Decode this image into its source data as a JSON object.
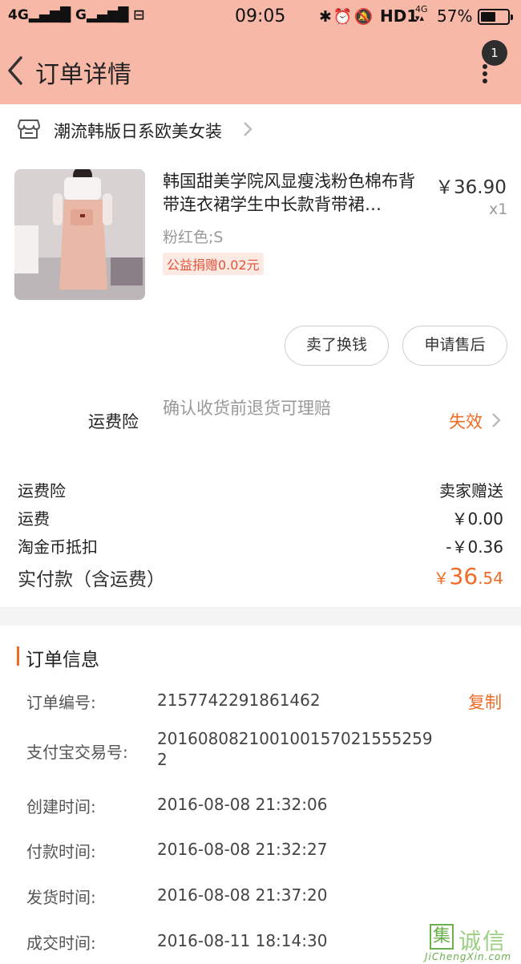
{
  "status_bar": {
    "signal": "4G",
    "signal2": "G",
    "time": "09:05",
    "hd": "HD1",
    "net": "4G",
    "battery_percent": "57%",
    "battery_level": 0.57
  },
  "header": {
    "title": "订单详情",
    "badge_count": "1",
    "background": "#f7b8a8"
  },
  "shop": {
    "name": "潮流韩版日系欧美女装"
  },
  "product": {
    "name": "韩国甜美学院风显瘦浅粉色棉布背带连衣裙学生中长款背带裙…",
    "price": "￥36.90",
    "quantity": "x1",
    "variant": "粉红色;S",
    "charity": "公益捐赠0.02元"
  },
  "actions": {
    "sell": "卖了换钱",
    "after_sales": "申请售后"
  },
  "freight_insurance": {
    "label": "运费险",
    "desc": "确认收货前退货可理赔",
    "status": "失效"
  },
  "summary": {
    "rows": [
      {
        "label": "运费险",
        "value": "卖家赠送"
      },
      {
        "label": "运费",
        "value": "￥0.00"
      },
      {
        "label": "淘金币抵扣",
        "value": "-￥0.36"
      }
    ],
    "total_label": "实付款（含运费）",
    "total_currency": "￥",
    "total_int": "36",
    "total_dec": ".54",
    "accent": "#f06a24"
  },
  "order_info": {
    "title": "订单信息",
    "copy": "复制",
    "items": [
      {
        "label": "订单编号:",
        "value": "2157742291861462"
      },
      {
        "label": "支付宝交易号:",
        "value": "2016080821001001570215552592"
      },
      {
        "label": "创建时间:",
        "value": "2016-08-08 21:32:06"
      },
      {
        "label": "付款时间:",
        "value": "2016-08-08 21:32:27"
      },
      {
        "label": "发货时间:",
        "value": "2016-08-08 21:37:20"
      },
      {
        "label": "成交时间:",
        "value": "2016-08-11 18:14:30"
      }
    ]
  },
  "watermark": {
    "mark": "集",
    "text": "诚信",
    "sub": "JiChengXin.com"
  }
}
